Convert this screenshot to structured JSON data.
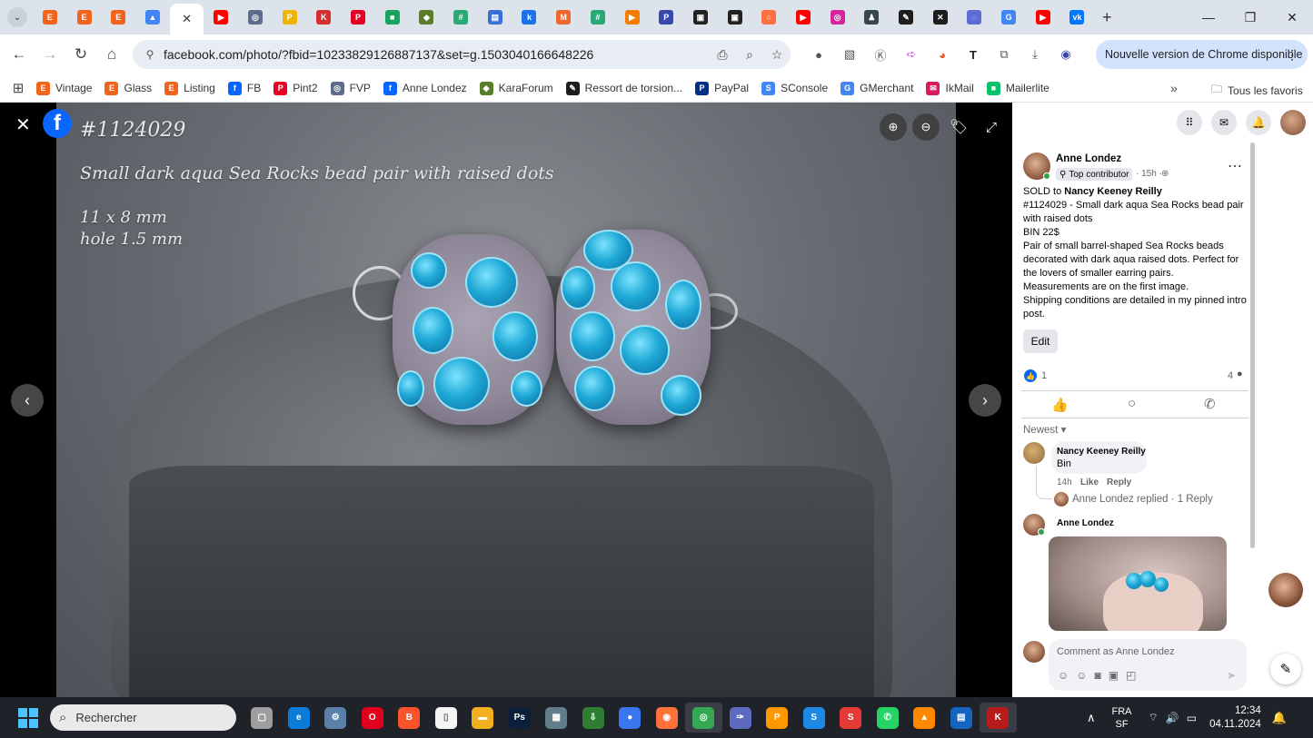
{
  "browser": {
    "tab_favicons": [
      {
        "icon": "etsy-icon",
        "letter": "E",
        "color": "#f1641e"
      },
      {
        "icon": "etsy-circle-icon",
        "letter": "E",
        "color": "#f1641e"
      },
      {
        "icon": "etsy-circle-icon",
        "letter": "E",
        "color": "#f1641e"
      },
      {
        "icon": "google-drive-icon",
        "letter": "▲",
        "color": "#4285f4"
      },
      {
        "icon": "facebook-icon",
        "letter": "f",
        "color": "#0866ff"
      },
      {
        "icon": "youtube-icon",
        "letter": "▶",
        "color": "#ff0000"
      },
      {
        "icon": "globe-icon",
        "letter": "◎",
        "color": "#5f6b8a"
      },
      {
        "icon": "paypal-icon",
        "letter": "P",
        "color": "#f0b400"
      },
      {
        "icon": "kara-icon",
        "letter": "K",
        "color": "#d32f2f"
      },
      {
        "icon": "pinterest-icon",
        "letter": "P",
        "color": "#e60023"
      },
      {
        "icon": "chat-icon",
        "letter": "■",
        "color": "#1aa260"
      },
      {
        "icon": "fish-icon",
        "letter": "◆",
        "color": "#5a7d2a"
      },
      {
        "icon": "grid-icon",
        "letter": "#",
        "color": "#2aa876"
      },
      {
        "icon": "print-icon",
        "letter": "▤",
        "color": "#3b6fd8"
      },
      {
        "icon": "k-icon",
        "letter": "k",
        "color": "#1a73e8"
      },
      {
        "icon": "magento-icon",
        "letter": "M",
        "color": "#ee672f"
      },
      {
        "icon": "grid-icon",
        "letter": "#",
        "color": "#2aa876"
      },
      {
        "icon": "play-icon",
        "letter": "▶",
        "color": "#f57c00"
      },
      {
        "icon": "p-circle-icon",
        "letter": "P",
        "color": "#3949ab"
      },
      {
        "icon": "window-icon",
        "letter": "▣",
        "color": "#222222"
      },
      {
        "icon": "window-icon",
        "letter": "▣",
        "color": "#222222"
      },
      {
        "icon": "circle-icon",
        "letter": "○",
        "color": "#ff7043"
      },
      {
        "icon": "youtube-icon",
        "letter": "▶",
        "color": "#ff0000"
      },
      {
        "icon": "instagram-icon",
        "letter": "◎",
        "color": "#d6249f"
      },
      {
        "icon": "person-icon",
        "letter": "♟",
        "color": "#37474f"
      },
      {
        "icon": "brush-icon",
        "letter": "✎",
        "color": "#1d1d1d"
      },
      {
        "icon": "bluesky-icon",
        "letter": "✕",
        "color": "#1d1d1d"
      },
      {
        "icon": "ring-icon",
        "letter": "◌",
        "color": "#5f6bd6"
      },
      {
        "icon": "google-icon",
        "letter": "G",
        "color": "#4285f4"
      },
      {
        "icon": "youtube-icon",
        "letter": "▶",
        "color": "#ff0000"
      },
      {
        "icon": "vk-icon",
        "letter": "vk",
        "color": "#0077ff"
      }
    ],
    "url": "facebook.com/photo/?fbid=10233829126887137&set=g.1503040166648226",
    "update_label": "Nouvelle version de Chrome disponible",
    "bookmarks": [
      {
        "label": "Vintage",
        "icon": "etsy-icon",
        "letter": "E",
        "color": "#f1641e"
      },
      {
        "label": "Glass",
        "icon": "etsy-icon",
        "letter": "E",
        "color": "#f1641e"
      },
      {
        "label": "Listing",
        "icon": "etsy-icon",
        "letter": "E",
        "color": "#f1641e"
      },
      {
        "label": "FB",
        "icon": "facebook-icon",
        "letter": "f",
        "color": "#0866ff"
      },
      {
        "label": "Pint2",
        "icon": "pinterest-icon",
        "letter": "P",
        "color": "#e60023"
      },
      {
        "label": "FVP",
        "icon": "globe-icon",
        "letter": "◎",
        "color": "#5f6b8a"
      },
      {
        "label": "Anne Londez",
        "icon": "facebook-icon",
        "letter": "f",
        "color": "#0866ff"
      },
      {
        "label": "KaraForum",
        "icon": "fish-icon",
        "letter": "◆",
        "color": "#5a7d2a"
      },
      {
        "label": "Ressort de torsion...",
        "icon": "brush-icon",
        "letter": "✎",
        "color": "#1d1d1d"
      },
      {
        "label": "PayPal",
        "icon": "paypal-icon",
        "letter": "P",
        "color": "#003087"
      },
      {
        "label": "SConsole",
        "icon": "search-console-icon",
        "letter": "S",
        "color": "#4285f4"
      },
      {
        "label": "GMerchant",
        "icon": "gmerchant-icon",
        "letter": "G",
        "color": "#4285f4"
      },
      {
        "label": "IkMail",
        "icon": "ikmail-icon",
        "letter": "✉",
        "color": "#d81b60"
      },
      {
        "label": "Mailerlite",
        "icon": "mailerlite-icon",
        "letter": "■",
        "color": "#09c269"
      }
    ],
    "all_bookmarks_label": "Tous les favoris"
  },
  "photo": {
    "code": "#1124029",
    "caption": "Small dark aqua Sea Rocks bead pair with raised dots",
    "dim1": "11 x 8 mm",
    "dim2": "hole 1.5 mm"
  },
  "post": {
    "author": "Anne Londez",
    "badge": "Top contributor",
    "time": "· 15h ·",
    "sold_prefix": "SOLD to ",
    "sold_to": "Nancy Keeney Reilly",
    "lines": [
      "#1124029 - Small dark aqua Sea Rocks bead pair with raised dots",
      "BIN 22$",
      "Pair of small barrel-shaped Sea Rocks beads decorated with dark aqua raised dots. Perfect for the lovers of smaller earring pairs.",
      "Measurements are on the first image.",
      "Shipping conditions are detailed in my pinned intro post."
    ],
    "edit_label": "Edit",
    "likes": "1",
    "comments_count": "4",
    "sort_label": "Newest"
  },
  "comments": [
    {
      "author": "Nancy Keeney Reilly",
      "text": "Bin",
      "time": "14h",
      "like": "Like",
      "reply": "Reply"
    }
  ],
  "replied_line": "Anne Londez replied · 1 Reply",
  "comment2_author": "Anne Londez",
  "comment_placeholder": "Comment as Anne Londez",
  "taskbar": {
    "search_placeholder": "Rechercher",
    "lang1": "FRA",
    "lang2": "SF",
    "time": "12:34",
    "date": "04.11.2024",
    "apps": [
      {
        "icon": "file-explorer-gray-icon",
        "letter": "▢",
        "color": "#9e9e9e"
      },
      {
        "icon": "edge-icon",
        "letter": "e",
        "color": "#0c7bd8"
      },
      {
        "icon": "settings-icon",
        "letter": "⚙",
        "color": "#5a7fa8"
      },
      {
        "icon": "opera-icon",
        "letter": "O",
        "color": "#e0001b"
      },
      {
        "icon": "brave-icon",
        "letter": "B",
        "color": "#fb542b"
      },
      {
        "icon": "notepad-icon",
        "letter": "▯",
        "color": "#f5f5f5"
      },
      {
        "icon": "file-explorer-icon",
        "letter": "▬",
        "color": "#f2b01e"
      },
      {
        "icon": "photoshop-icon",
        "letter": "Ps",
        "color": "#0b1f3a"
      },
      {
        "icon": "calculator-icon",
        "letter": "▦",
        "color": "#607d8b"
      },
      {
        "icon": "download-app-icon",
        "letter": "⇩",
        "color": "#2e7d32"
      },
      {
        "icon": "signal-icon",
        "letter": "●",
        "color": "#3a76f0"
      },
      {
        "icon": "firefox-icon",
        "letter": "◉",
        "color": "#ff7139"
      },
      {
        "icon": "chrome-icon",
        "letter": "◎",
        "color": "#34a853"
      },
      {
        "icon": "feather-icon",
        "letter": "✑",
        "color": "#5c6bc0"
      },
      {
        "icon": "pdf-icon",
        "letter": "P",
        "color": "#ff9800"
      },
      {
        "icon": "s-app-icon",
        "letter": "S",
        "color": "#1e88e5"
      },
      {
        "icon": "s-red-icon",
        "letter": "S",
        "color": "#e53935"
      },
      {
        "icon": "whatsapp-icon",
        "letter": "✆",
        "color": "#25d366"
      },
      {
        "icon": "vlc-icon",
        "letter": "▲",
        "color": "#ff8800"
      },
      {
        "icon": "doc-icon",
        "letter": "▤",
        "color": "#1565c0"
      },
      {
        "icon": "k-app-icon",
        "letter": "K",
        "color": "#b71c1c"
      }
    ]
  }
}
